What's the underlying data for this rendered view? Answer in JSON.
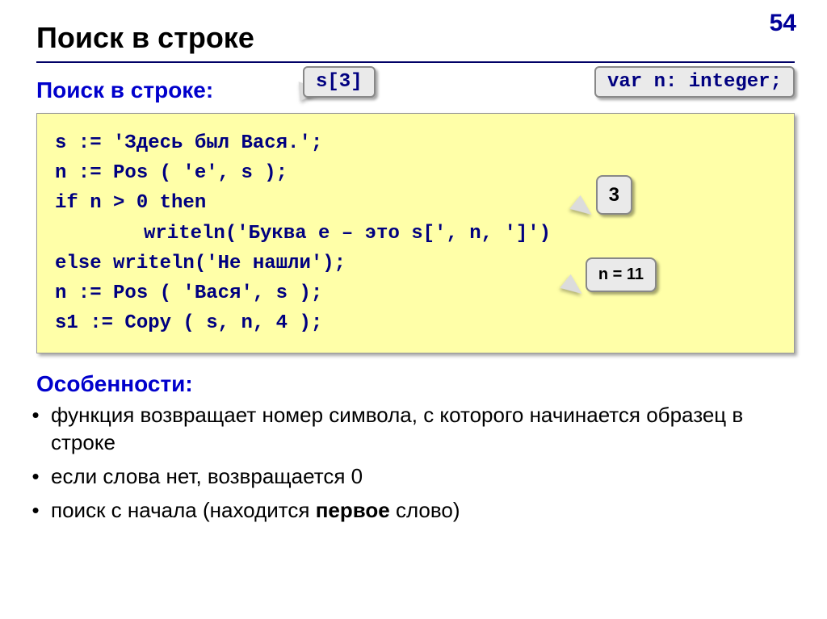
{
  "page_number": "54",
  "title": "Поиск в строке",
  "subtitle": "Поиск в строке:",
  "chip_s3": "s[3]",
  "chip_var": "var n: integer;",
  "code": {
    "l1": "s := 'Здесь был Вася.';",
    "l2": "n := Pos ( 'е', s );",
    "l3": "if n > 0 then",
    "l4": "writeln('Буква е – это s[', n, ']')",
    "l5": "else writeln('Не нашли');",
    "l6": "n := Pos ( 'Вася', s );",
    "l7": "s1 := Copy ( s, n, 4 );"
  },
  "badge_3": "3",
  "badge_n11": "n = 11",
  "features_title": "Особенности:",
  "features": {
    "f1a": "функция возвращает номер символа, с которого начинается образец в строке",
    "f2": "если слова нет, возвращается 0",
    "f3a": "поиск с начала (находится ",
    "f3b": "первое",
    "f3c": " слово)"
  }
}
